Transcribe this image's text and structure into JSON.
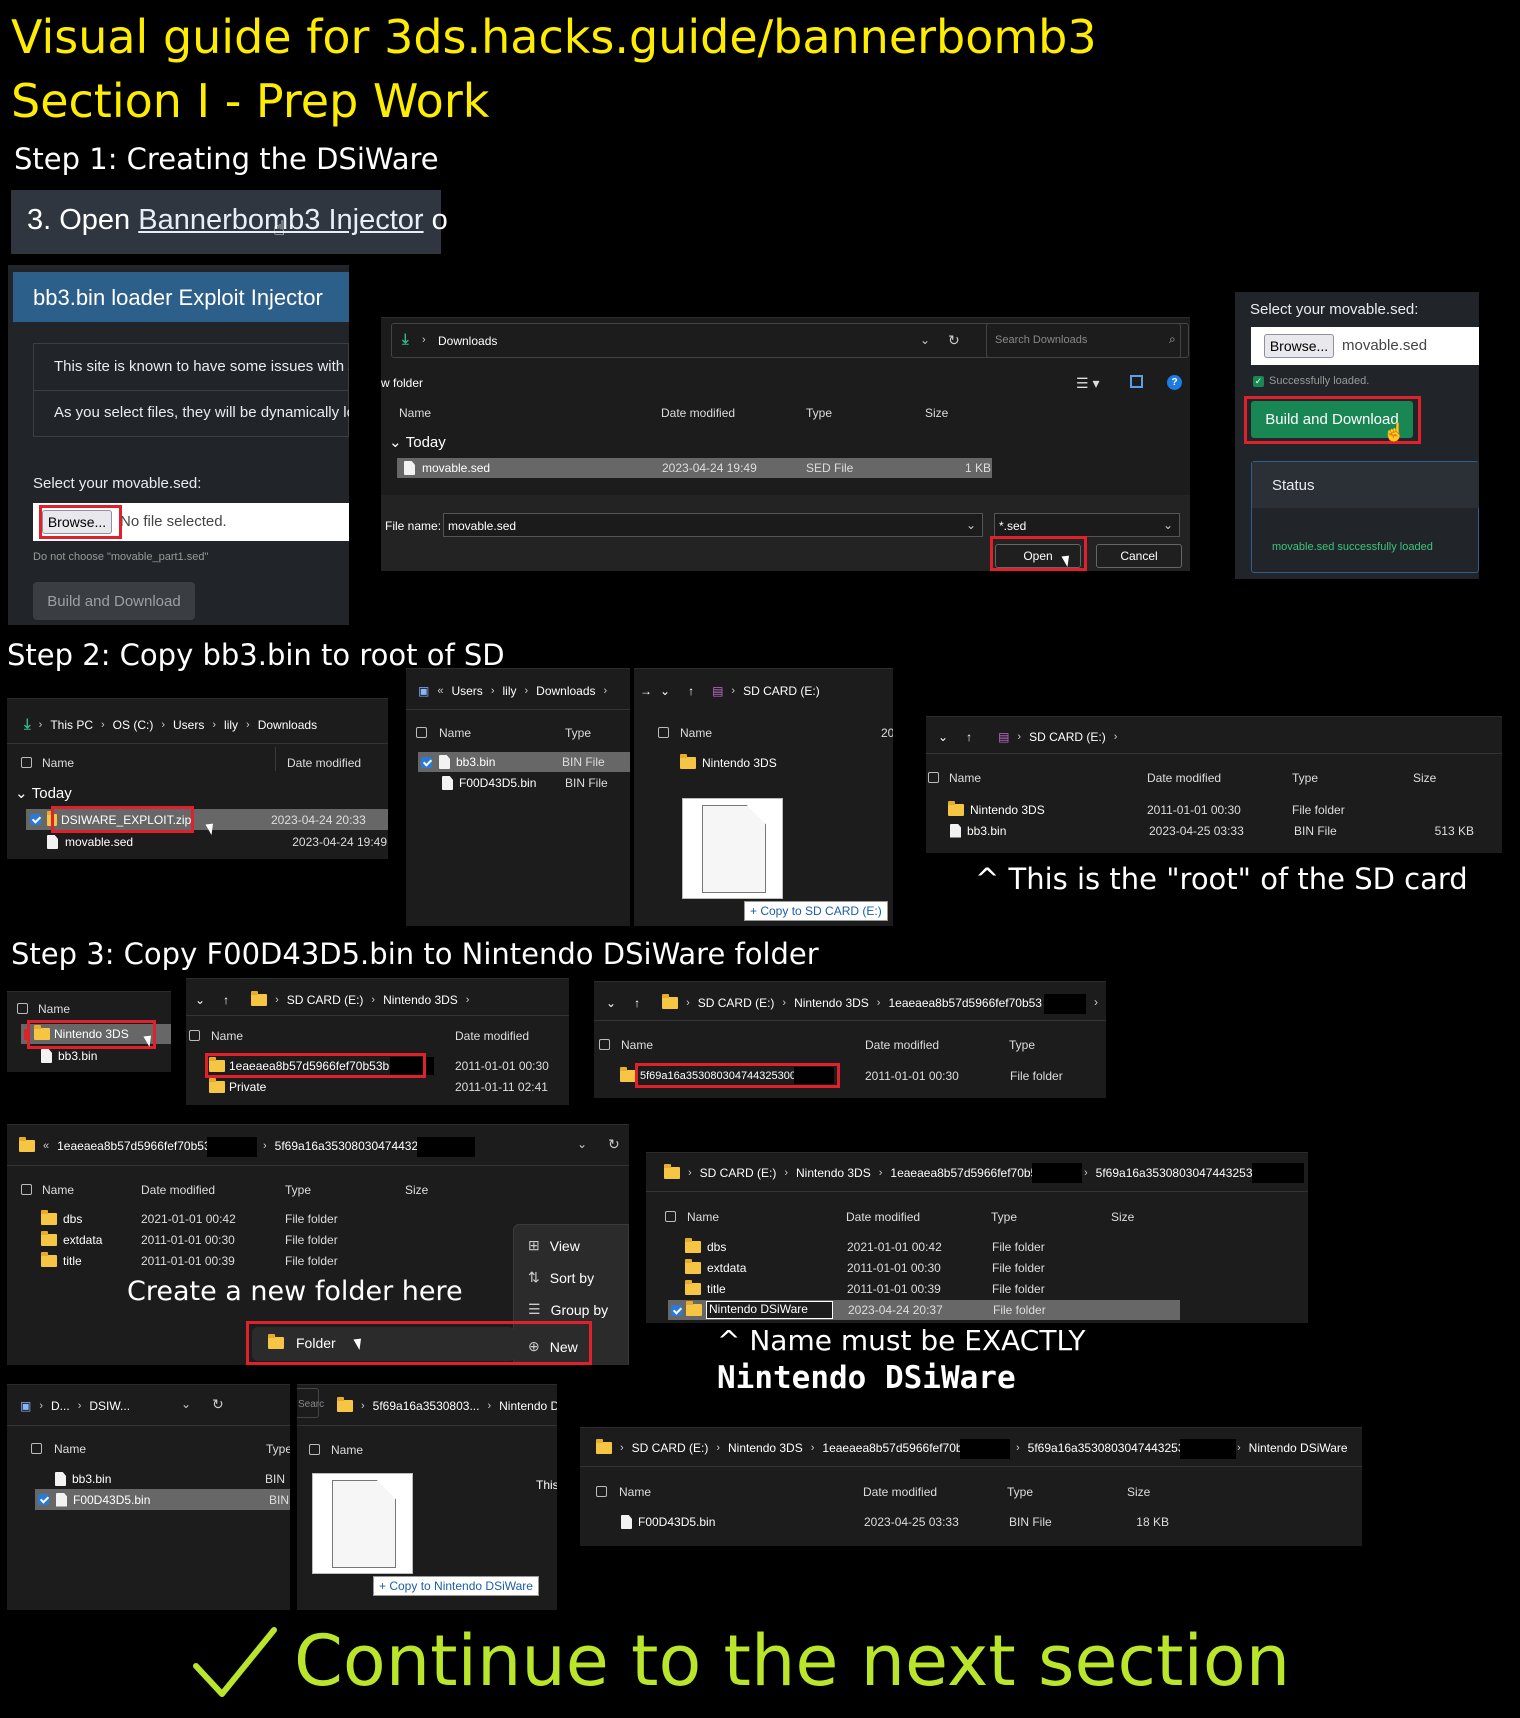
{
  "title1": "Visual guide for 3ds.hacks.guide/bannerbomb3",
  "title2": "Section I - Prep Work",
  "step1": "Step 1: Creating the DSiWare",
  "step2": "Step 2: Copy bb3.bin to root of SD",
  "step3": "Step 3: Copy F00D43D5.bin to Nintendo DSiWare folder",
  "continue_text": "Continue to the next section",
  "colors": {
    "yellow": "#ffed00",
    "green": "#b9e52b",
    "red": "#e0202a",
    "injector_blue": "#2c5f8a",
    "build_green": "#198754"
  },
  "s1": {
    "open_prefix": "3. Open ",
    "open_link": "Bannerbomb3 Injector",
    "open_suffix": " o",
    "inj_title": "bb3.bin loader Exploit Injector",
    "note1": "This site is known to have some issues with so",
    "note2": "As you select files, they will be dynamically lo",
    "select_label": "Select your movable.sed:",
    "browse": "Browse...",
    "no_file": "No file selected.",
    "hint": "Do not choose \"movable_part1.sed\"",
    "build_disabled": "Build and Download",
    "dlg_path": "Downloads",
    "dlg_search": "Search Downloads",
    "dlg_newfolder": "w folder",
    "cols": {
      "name": "Name",
      "date": "Date modified",
      "type": "Type",
      "size": "Size"
    },
    "group": "Today",
    "file": {
      "name": "movable.sed",
      "date": "2023-04-24 19:49",
      "type": "SED File",
      "size": "1 KB"
    },
    "filename_label": "File name:",
    "filename": "movable.sed",
    "filter": "*.sed",
    "open_btn": "Open",
    "cancel_btn": "Cancel",
    "r_label": "Select your movable.sed:",
    "r_browse": "Browse...",
    "r_file": "movable.sed",
    "r_loaded": "Successfully loaded.",
    "r_build": "Build and Download",
    "r_status": "Status",
    "r_status_msg": "movable.sed successfully loaded"
  },
  "s2": {
    "crumb": [
      "This PC",
      "OS (C:)",
      "Users",
      "lily",
      "Downloads"
    ],
    "name_col": "Name",
    "date_col": "Date modified",
    "group": "Today",
    "zip": {
      "name": "DSIWARE_EXPLOIT.zip",
      "date": "2023-04-24 20:33"
    },
    "sed": {
      "name": "movable.sed",
      "date": "2023-04-24 19:49"
    },
    "mid_crumb": [
      "Users",
      "lily",
      "Downloads"
    ],
    "mid_type": "Type",
    "mid_files": [
      {
        "name": "bb3.bin",
        "type": "BIN File"
      },
      {
        "name": "F00D43D5.bin",
        "type": "BIN File"
      }
    ],
    "sd_label": "SD CARD (E:)",
    "sd_mid_folder": "Nintendo 3DS",
    "sd_mid_date": "20",
    "copy_tip": "+ Copy to SD CARD (E:)",
    "root_crumb": "SD CARD (E:)",
    "cols": {
      "name": "Name",
      "date": "Date modified",
      "type": "Type",
      "size": "Size"
    },
    "root_rows": [
      {
        "name": "Nintendo 3DS",
        "date": "2011-01-01 00:30",
        "type": "File folder",
        "size": ""
      },
      {
        "name": "bb3.bin",
        "date": "2023-04-25 03:33",
        "type": "BIN File",
        "size": "513 KB"
      }
    ],
    "caption": "^ This is the \"root\" of the SD card"
  },
  "s3": {
    "p1": {
      "name_col": "Name",
      "rows": [
        "Nintendo 3DS",
        "bb3.bin"
      ]
    },
    "p2": {
      "crumb": [
        "SD CARD (E:)",
        "Nintendo 3DS"
      ],
      "name_col": "Name",
      "date_col": "Date modified",
      "rows": [
        {
          "name": "1eaeaea8b57d5966fef70b53b",
          "date": "2011-01-01 00:30"
        },
        {
          "name": "Private",
          "date": "2011-01-11 02:41"
        }
      ]
    },
    "p3": {
      "crumb": [
        "SD CARD (E:)",
        "Nintendo 3DS",
        "1eaeaea8b57d5966fef70b53"
      ],
      "name_col": "Name",
      "date_col": "Date modified",
      "type_col": "Type",
      "row": {
        "name": "5f69a16a353080304744325300",
        "date": "2011-01-01 00:30",
        "type": "File folder"
      }
    },
    "p4": {
      "crumb": [
        "1eaeaea8b57d5966fef70b53b",
        "5f69a16a35308030474432530"
      ],
      "cols": {
        "name": "Name",
        "date": "Date modified",
        "type": "Type",
        "size": "Size"
      },
      "rows": [
        {
          "name": "dbs",
          "date": "2021-01-01 00:42",
          "type": "File folder"
        },
        {
          "name": "extdata",
          "date": "2011-01-01 00:30",
          "type": "File folder"
        },
        {
          "name": "title",
          "date": "2011-01-01 00:39",
          "type": "File folder"
        }
      ],
      "caption": "Create a new folder here",
      "menu": [
        "View",
        "Sort by",
        "Group by",
        "New"
      ],
      "folder_item": "Folder"
    },
    "p5": {
      "crumb": [
        "SD CARD (E:)",
        "Nintendo 3DS",
        "1eaeaea8b57d5966fef70b53",
        "5f69a16a35308030474432530"
      ],
      "cols": {
        "name": "Name",
        "date": "Date modified",
        "type": "Type",
        "size": "Size"
      },
      "rows": [
        {
          "name": "dbs",
          "date": "2021-01-01 00:42",
          "type": "File folder"
        },
        {
          "name": "extdata",
          "date": "2011-01-01 00:30",
          "type": "File folder"
        },
        {
          "name": "title",
          "date": "2011-01-01 00:39",
          "type": "File folder"
        },
        {
          "name": "Nintendo DSiWare",
          "date": "2023-04-24 20:37",
          "type": "File folder"
        }
      ],
      "caption1": "^ Name must be EXACTLY",
      "caption2": "Nintendo DSiWare"
    },
    "p6": {
      "crumb": [
        "D...",
        "DSIW..."
      ],
      "name_col": "Name",
      "type_col": "Type",
      "rows": [
        {
          "name": "bb3.bin",
          "type": "BIN"
        },
        {
          "name": "F00D43D5.bin",
          "type": "BIN"
        }
      ],
      "search": "Searc",
      "r_crumb": [
        "5f69a16a3530803...",
        "Nintendo DSiWare"
      ],
      "r_name_col": "Name",
      "this_text": "This",
      "copy_tip": "+ Copy to Nintendo DSiWare"
    },
    "p7": {
      "crumb": [
        "SD CARD (E:)",
        "Nintendo 3DS",
        "1eaeaea8b57d5966fef70b53",
        "5f69a16a35308030474432530",
        "Nintendo DSiWare"
      ],
      "cols": {
        "name": "Name",
        "date": "Date modified",
        "type": "Type",
        "size": "Size"
      },
      "row": {
        "name": "F00D43D5.bin",
        "date": "2023-04-25 03:33",
        "type": "BIN File",
        "size": "18 KB"
      }
    }
  }
}
